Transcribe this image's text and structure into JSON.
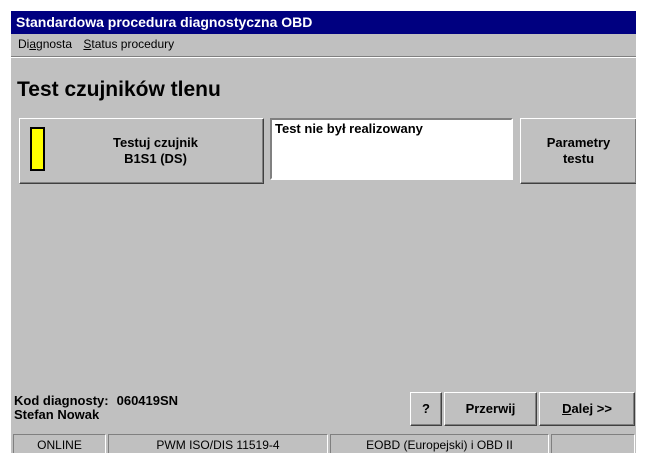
{
  "window": {
    "title": "Standardowa procedura diagnostyczna OBD"
  },
  "menu": {
    "items": [
      {
        "label_pre": "Di",
        "accel": "a",
        "label_post": "gnosta"
      },
      {
        "label_pre": "",
        "accel": "S",
        "label_post": "tatus procedury"
      }
    ]
  },
  "page": {
    "title": "Test czujników tlenu"
  },
  "test": {
    "button_line1": "Testuj czujnik",
    "button_line2": "B1S1 (DS)",
    "indicator_color": "#ffff00",
    "status_text": "Test nie był realizowany"
  },
  "params": {
    "line1": "Parametry",
    "line2": "testu"
  },
  "diagnostician": {
    "code_label": "Kod diagnosty:",
    "code_value": "060419SN",
    "name": "Stefan Nowak"
  },
  "buttons": {
    "help": "?",
    "abort": "Przerwij",
    "next_accel": "D",
    "next_rest": "alej >>"
  },
  "statusbar": {
    "cells": [
      "ONLINE",
      "PWM ISO/DIS 11519-4",
      "EOBD (Europejski) i OBD II",
      ""
    ]
  },
  "colors": {
    "title_bar": "#000080",
    "face": "#c0c0c0"
  }
}
